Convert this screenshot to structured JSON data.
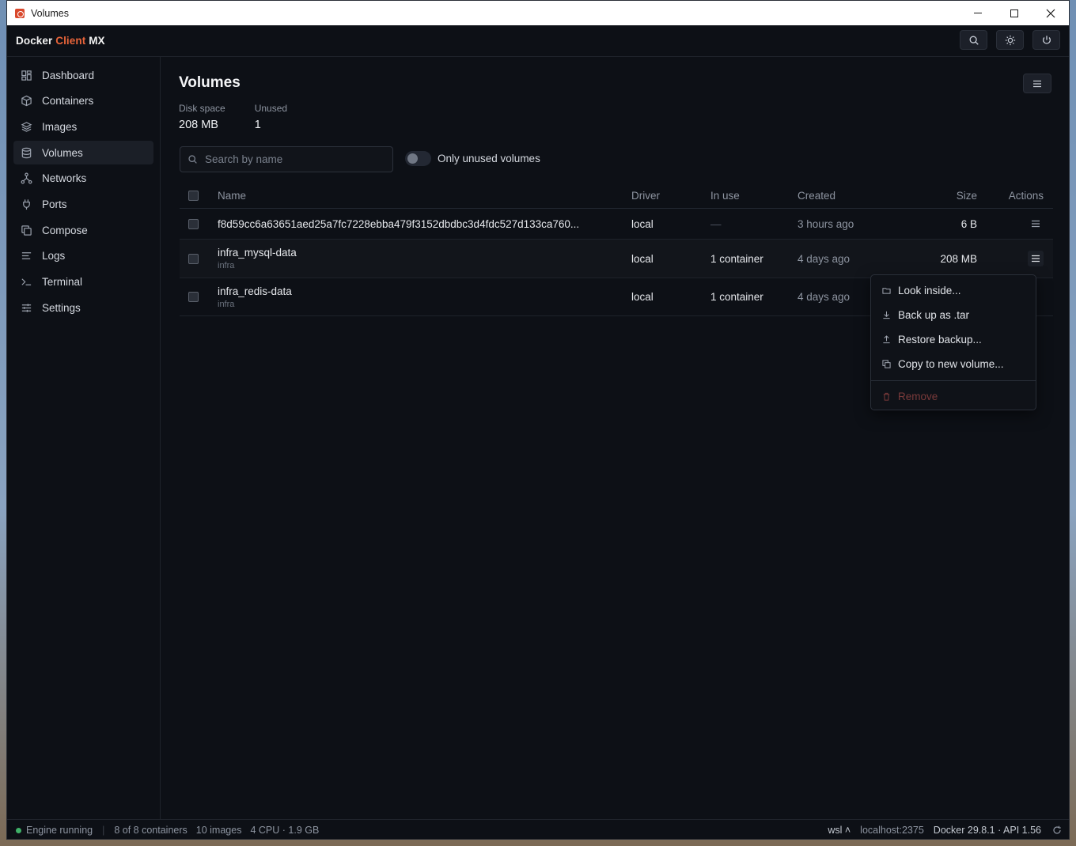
{
  "window": {
    "title": "Volumes"
  },
  "app": {
    "brand_first": "Docker ",
    "brand_accent": "Client",
    "brand_last": " MX"
  },
  "sidebar": {
    "items": [
      {
        "label": "Dashboard",
        "icon": "dashboard-icon"
      },
      {
        "label": "Containers",
        "icon": "box-icon"
      },
      {
        "label": "Images",
        "icon": "layers-icon"
      },
      {
        "label": "Volumes",
        "icon": "database-icon",
        "active": true
      },
      {
        "label": "Networks",
        "icon": "network-icon"
      },
      {
        "label": "Ports",
        "icon": "plug-icon"
      },
      {
        "label": "Compose",
        "icon": "copy-icon"
      },
      {
        "label": "Logs",
        "icon": "lines-icon"
      },
      {
        "label": "Terminal",
        "icon": "terminal-icon"
      },
      {
        "label": "Settings",
        "icon": "sliders-icon"
      }
    ]
  },
  "page": {
    "title": "Volumes",
    "stats": {
      "disk_label": "Disk space",
      "disk_value": "208 MB",
      "unused_label": "Unused",
      "unused_value": "1"
    },
    "search_placeholder": "Search by name",
    "toggle_label": "Only unused volumes"
  },
  "table": {
    "headers": {
      "name": "Name",
      "driver": "Driver",
      "inuse": "In use",
      "created": "Created",
      "size": "Size",
      "actions": "Actions"
    },
    "rows": [
      {
        "name": "f8d59cc6a63651aed25a7fc7228ebba479f3152dbdbc3d4fdc527d133ca760...",
        "project": "",
        "driver": "local",
        "inuse": "—",
        "created": "3 hours ago",
        "size": "6 B"
      },
      {
        "name": "infra_mysql-data",
        "project": "infra",
        "driver": "local",
        "inuse": "1 container",
        "created": "4 days ago",
        "size": "208 MB"
      },
      {
        "name": "infra_redis-data",
        "project": "infra",
        "driver": "local",
        "inuse": "1 container",
        "created": "4 days ago",
        "size": ""
      }
    ]
  },
  "dropdown": {
    "items": [
      {
        "label": "Look inside...",
        "icon": "folder-icon"
      },
      {
        "label": "Back up as .tar",
        "icon": "download-icon"
      },
      {
        "label": "Restore backup...",
        "icon": "upload-icon"
      },
      {
        "label": "Copy to new volume...",
        "icon": "copy-icon"
      }
    ],
    "danger_label": "Remove"
  },
  "statusbar": {
    "engine": "Engine running",
    "containers": "8 of 8 containers",
    "images": "10 images",
    "resources": "4 CPU · 1.9 GB",
    "context": "wsl ˄",
    "host": "localhost:2375",
    "version": "Docker 29.8.1 · API 1.56"
  },
  "colors": {
    "accent": "#e8643a",
    "status_ok": "#3fb168",
    "background": "#0d1016"
  }
}
